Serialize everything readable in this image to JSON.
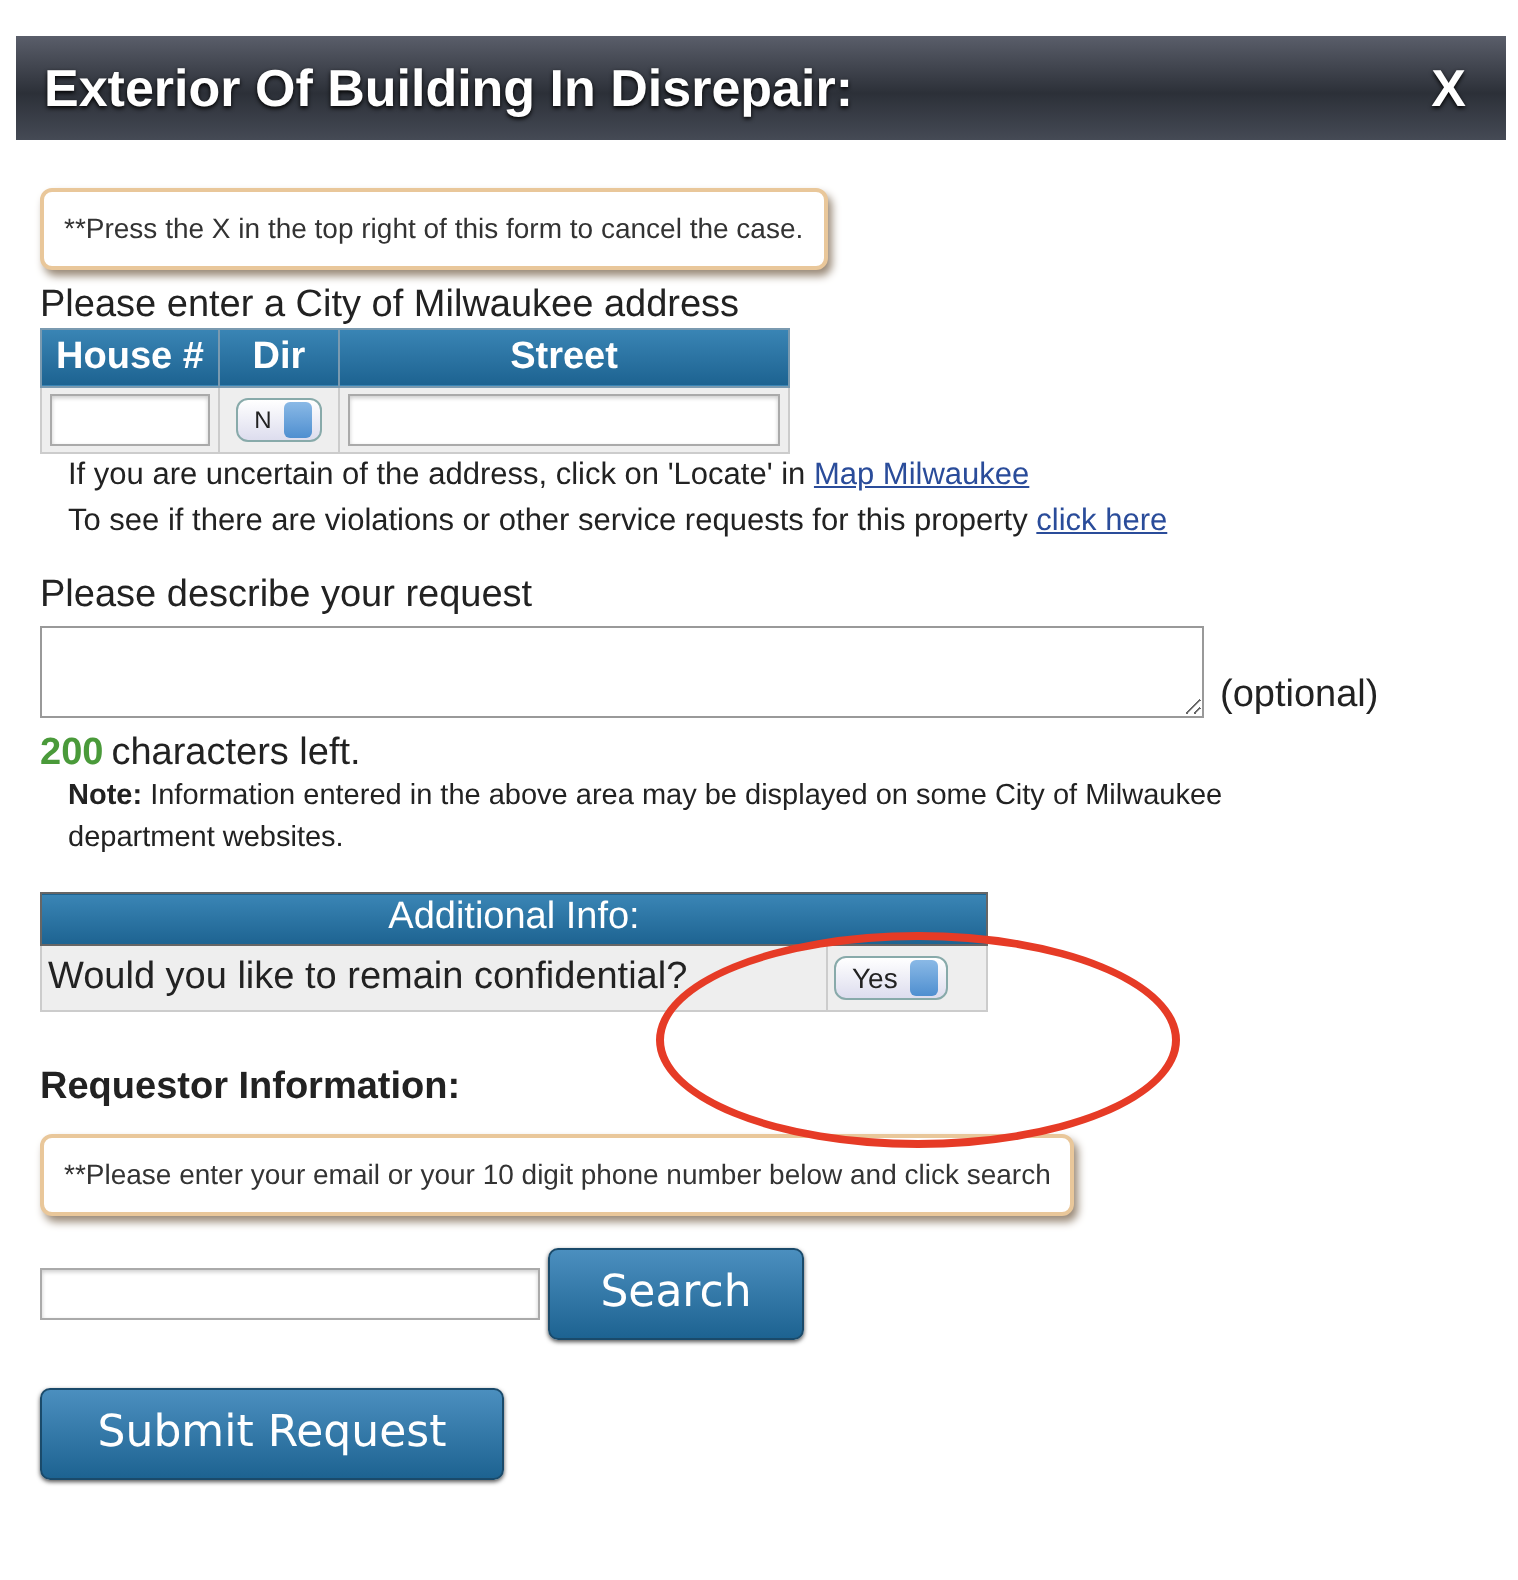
{
  "window": {
    "title": "Exterior Of Building In Disrepair:",
    "close": "X"
  },
  "cancel_note": "**Press the X in the top right of this form to cancel the case.",
  "address": {
    "label": "Please enter a City of Milwaukee address",
    "columns": [
      "House #",
      "Dir",
      "Street"
    ],
    "dir_value": "N",
    "help": [
      {
        "text": "If you are uncertain of the address, click on 'Locate' in ",
        "link": "Map Milwaukee"
      },
      {
        "text": "To see if there are violations or other service requests for this property ",
        "link": "click here"
      }
    ]
  },
  "request": {
    "label": "Please describe your request",
    "optional": "(optional)",
    "count": "200",
    "count_text": "characters left.",
    "note": "**Note:** Information entered in the above area may be displayed on some City of Milwaukee department websites."
  },
  "additional": {
    "heading": "Additional Info:",
    "question": "Would you like to remain confidential?",
    "value": "Yes"
  },
  "annotation": {
    "kind": "ellipse"
  },
  "requestor": {
    "heading": "Requestor Information:",
    "note": "**Please enter your email or your 10 digit phone number below and click search",
    "search_button": "Search"
  },
  "submit_button": "Submit Request"
}
